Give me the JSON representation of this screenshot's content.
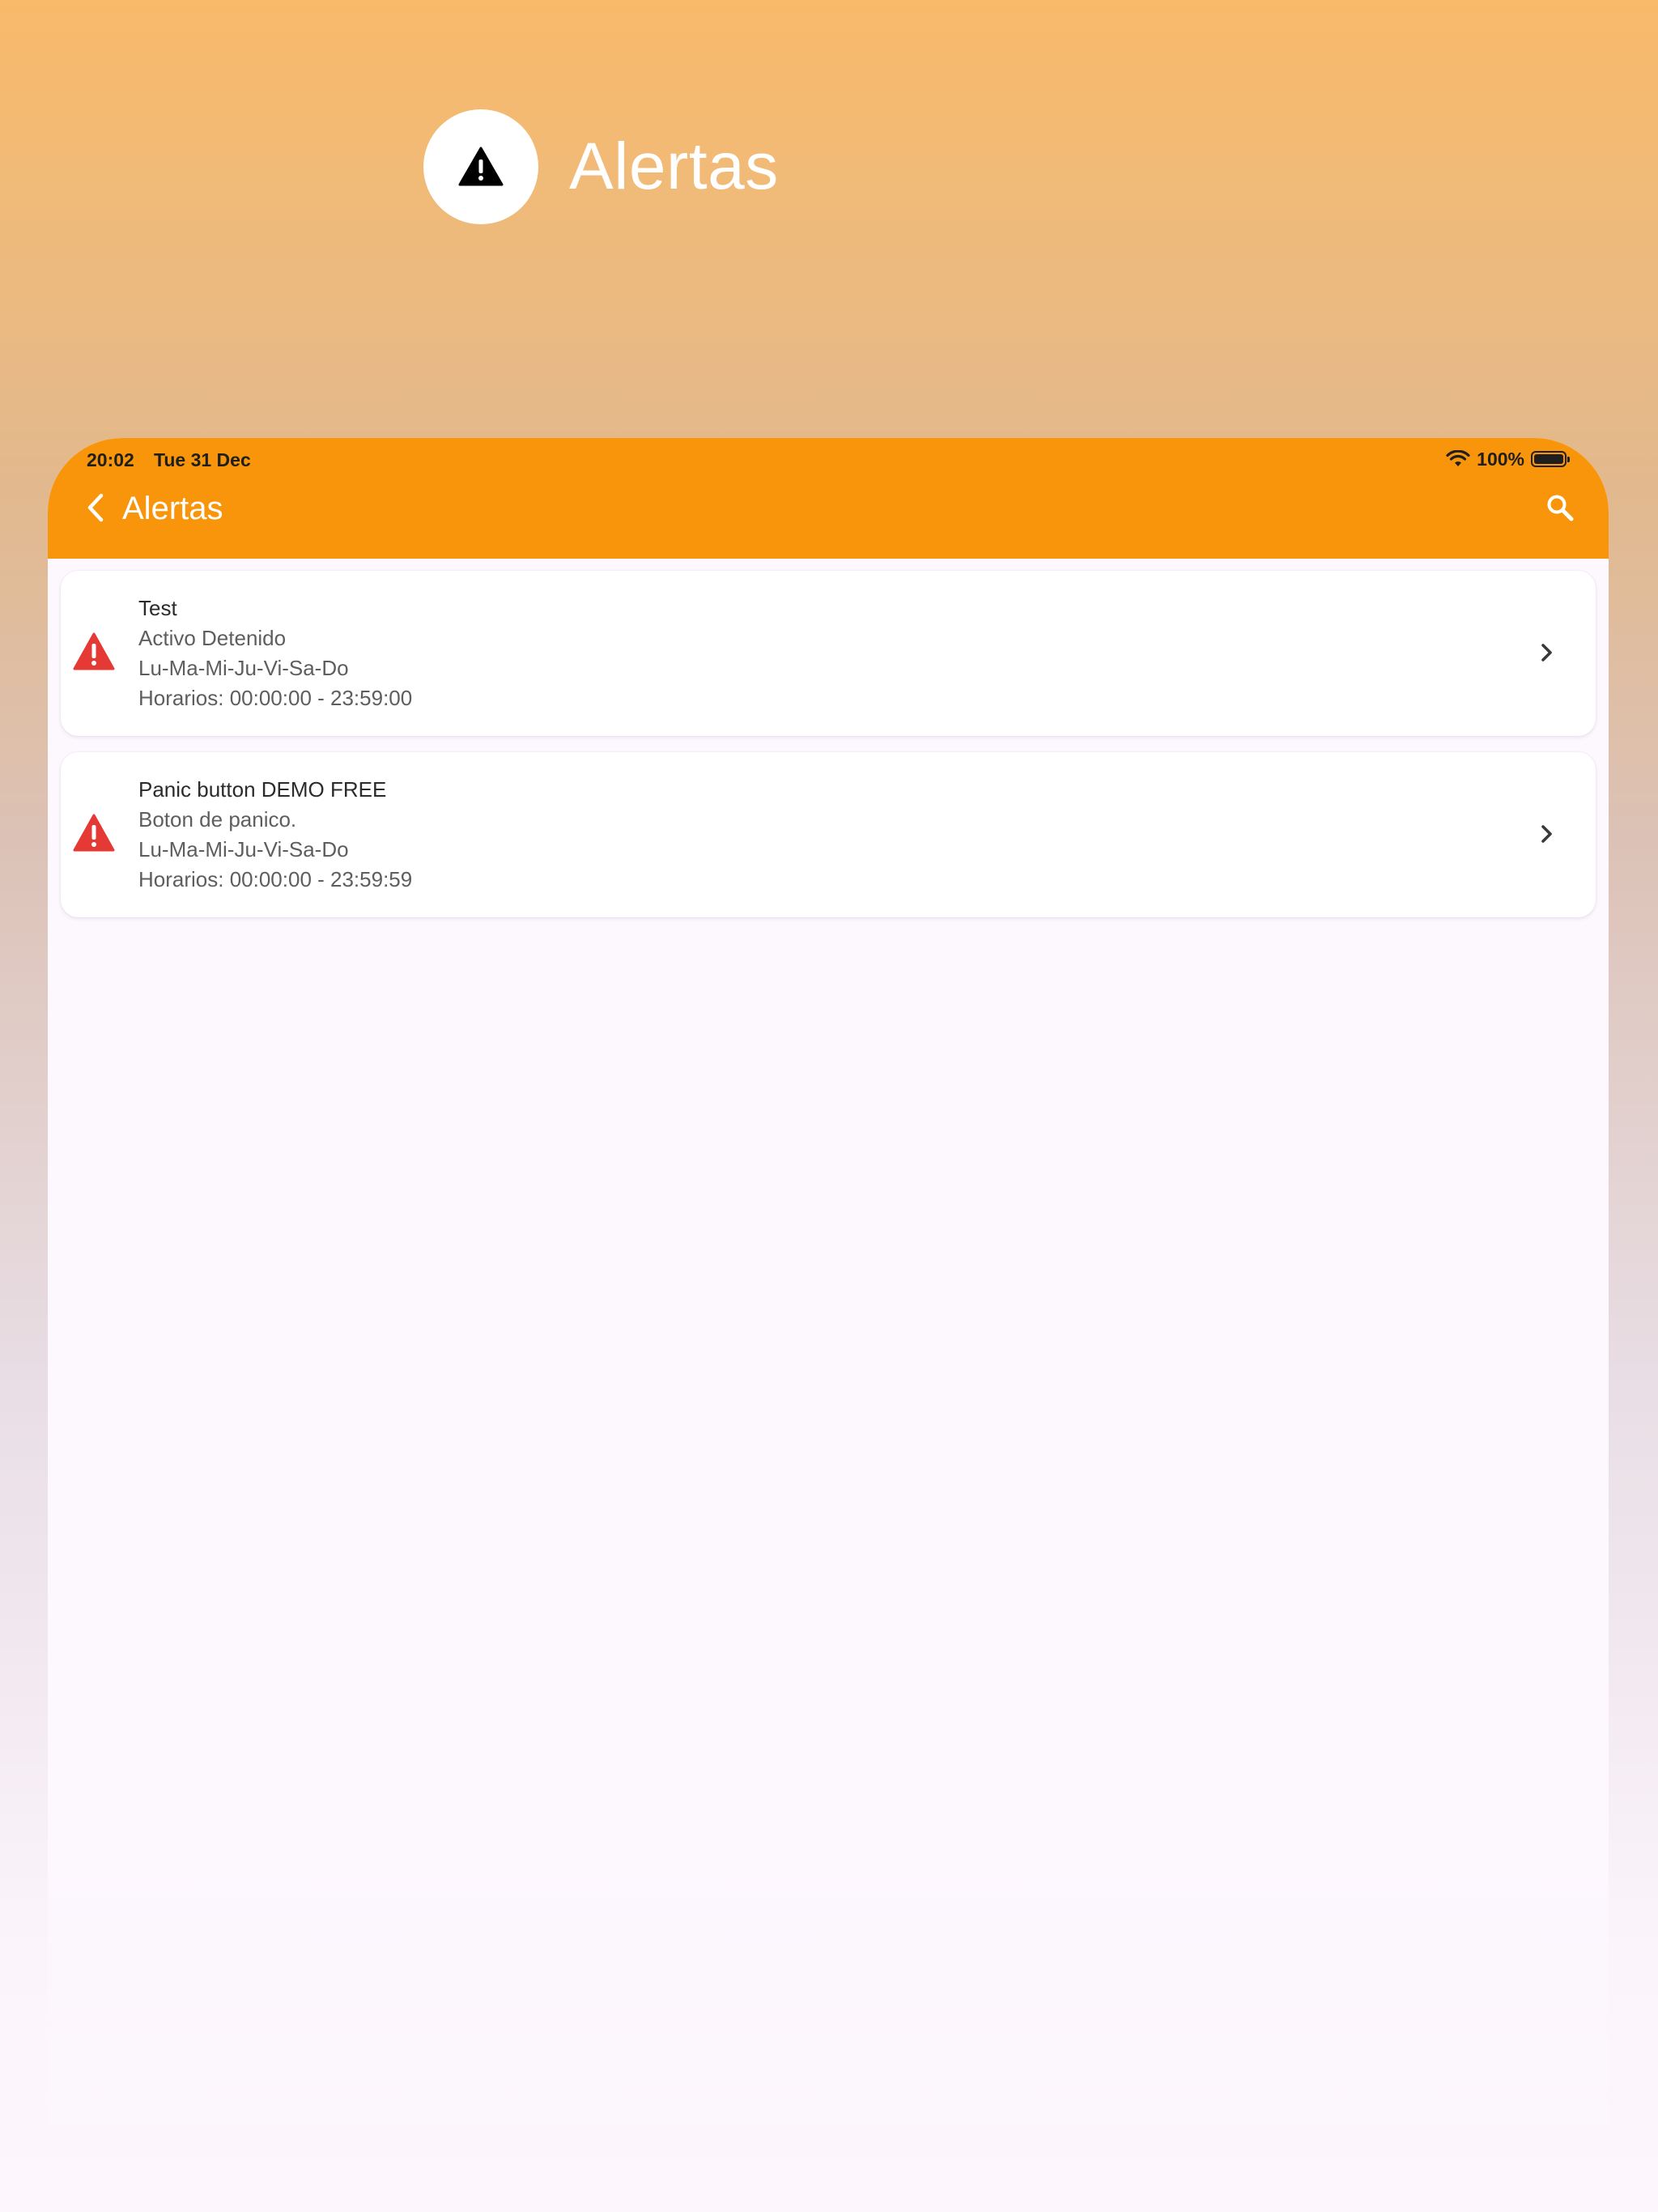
{
  "hero": {
    "title": "Alertas",
    "icon": "warning-icon"
  },
  "status_bar": {
    "time": "20:02",
    "date": "Tue 31 Dec",
    "battery_percent": "100%",
    "wifi_icon": "wifi-icon",
    "battery_icon": "battery-icon"
  },
  "app_bar": {
    "title": "Alertas",
    "back_icon": "chevron-left-icon",
    "search_icon": "search-icon",
    "background_color": "#F9950A"
  },
  "alerts": [
    {
      "title": "Test",
      "description": "Activo Detenido",
      "days": "Lu-Ma-Mi-Ju-Vi-Sa-Do",
      "schedule": "Horarios: 00:00:00 - 23:59:00"
    },
    {
      "title": "Panic button DEMO FREE",
      "description": "Boton de panico.",
      "days": "Lu-Ma-Mi-Ju-Vi-Sa-Do",
      "schedule": "Horarios: 00:00:00 - 23:59:59"
    }
  ],
  "colors": {
    "alert_icon": "#E53935",
    "accent": "#F9950A"
  }
}
